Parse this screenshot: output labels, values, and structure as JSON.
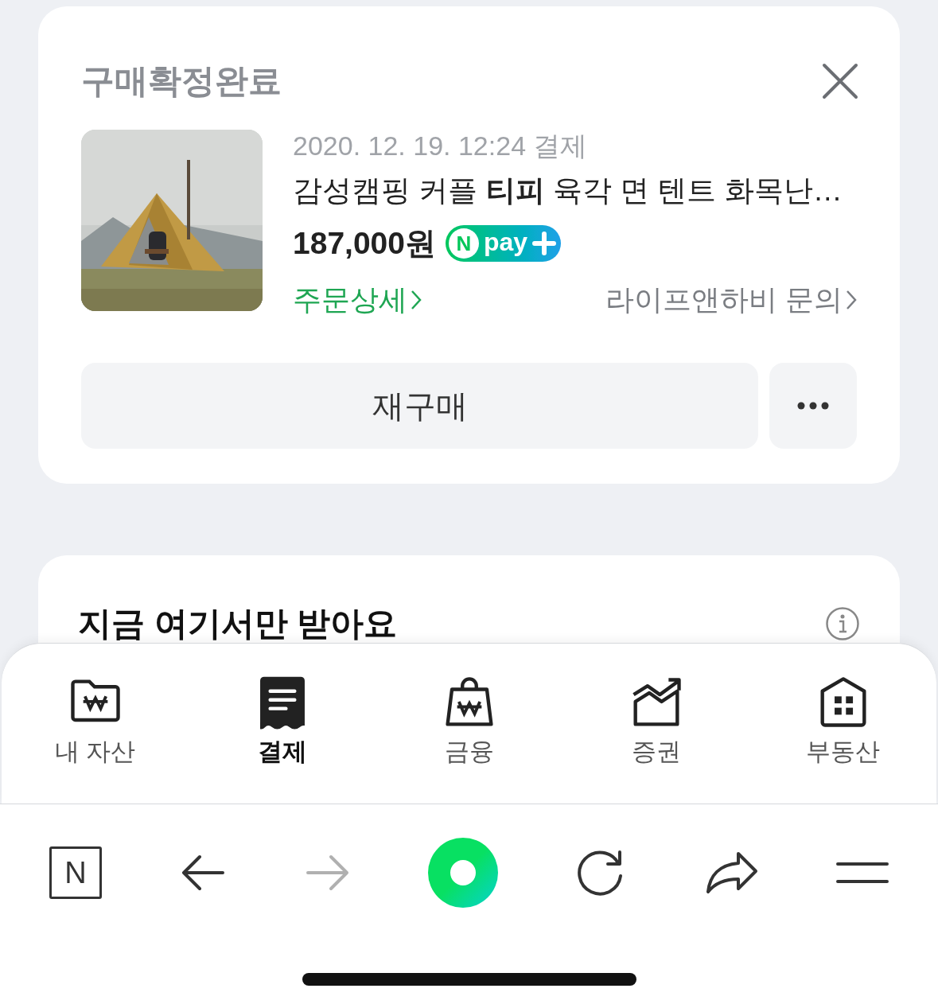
{
  "order_card": {
    "status": "구매확정완료",
    "kind": "picture",
    "date": "2020. 12. 19. 12:24 결제",
    "product": "감성캠핑 커플 **티피** 육각 면 텐트 화목난…",
    "price": "187,000원",
    "pay_badge": {
      "letter": "N",
      "label": "pay"
    },
    "detail_link": "주문상세",
    "inquiry_link": "라이프앤하비 문의",
    "rebuy_button": "재구매"
  },
  "promo_card": {
    "title": "지금 여기서만 받아요"
  },
  "bottom_tabs": [
    {
      "label": "내 자산",
      "selected": false
    },
    {
      "label": "결제",
      "selected": true
    },
    {
      "label": "금융",
      "selected": false
    },
    {
      "label": "증권",
      "selected": false
    },
    {
      "label": "부동산",
      "selected": false
    }
  ],
  "browser_bar": {
    "home_letter": "N",
    "forward_disabled": true
  }
}
